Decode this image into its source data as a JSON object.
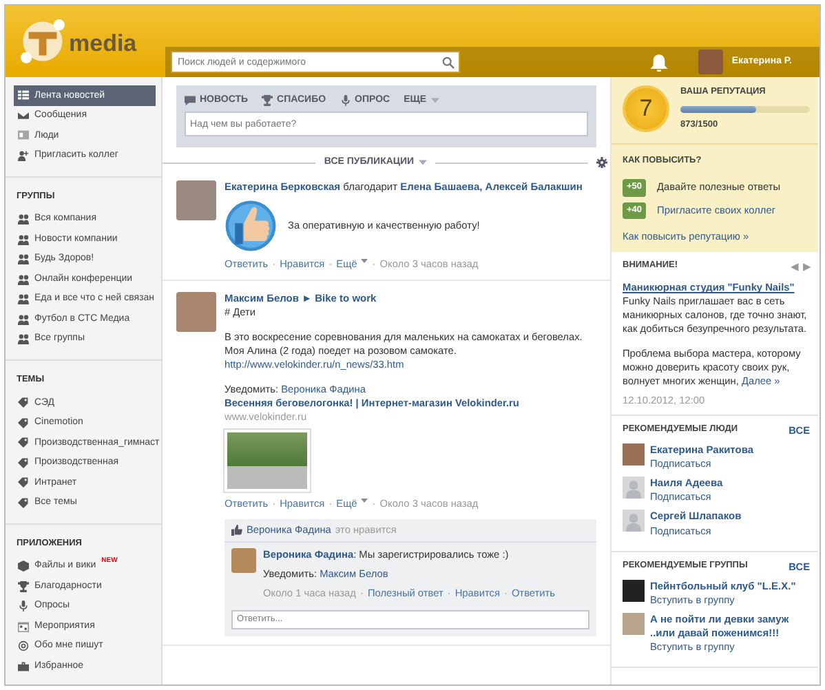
{
  "header": {
    "logo_text": "media",
    "search": {
      "placeholder": "Поиск людей и содержимого"
    },
    "user_name": "Екатерина Р."
  },
  "sidebar": {
    "sections": [
      {
        "items": [
          {
            "label": "Лента новостей",
            "selected": true
          },
          {
            "label": "Сообщения",
            "selected": false
          },
          {
            "label": "Люди",
            "selected": false
          },
          {
            "label": "Пригласить коллег",
            "selected": false
          }
        ]
      },
      {
        "title": "ГРУППЫ",
        "items": [
          {
            "label": "Вся компания",
            "selected": false
          },
          {
            "label": "Новости компании",
            "selected": false
          },
          {
            "label": "Будь Здоров!",
            "selected": false
          },
          {
            "label": "Онлайн конференции",
            "selected": false
          },
          {
            "label": "Еда и все что с ней связан",
            "selected": false
          },
          {
            "label": "Футбол в СТС Медиа",
            "selected": false
          },
          {
            "label": "Все группы",
            "selected": false
          }
        ]
      },
      {
        "title": "ТЕМЫ",
        "items": [
          {
            "label": "СЭД",
            "selected": false
          },
          {
            "label": "Cinemotion",
            "selected": false
          },
          {
            "label": "Производственная_гимнаст",
            "selected": false
          },
          {
            "label": "Производственная",
            "selected": false
          },
          {
            "label": "Интранет",
            "selected": false
          },
          {
            "label": "Все темы",
            "selected": false
          }
        ]
      },
      {
        "title": "ПРИЛОЖЕНИЯ",
        "items": [
          {
            "label": "Файлы и вики",
            "badge": "NEW",
            "selected": false
          },
          {
            "label": "Благодарности",
            "selected": false
          },
          {
            "label": "Опросы",
            "selected": false
          },
          {
            "label": "Мероприятия",
            "selected": false
          },
          {
            "label": "Обо мне пишут",
            "selected": false
          },
          {
            "label": "Избранное",
            "selected": false
          }
        ]
      }
    ]
  },
  "composer": {
    "tabs": [
      {
        "label": "НОВОСТЬ"
      },
      {
        "label": "СПАСИБО"
      },
      {
        "label": "ОПРОС"
      },
      {
        "label": "ЕЩЕ"
      }
    ],
    "placeholder": "Над чем вы работаете?"
  },
  "feed_filter": "ВСЕ ПУБЛИКАЦИИ",
  "posts": [
    {
      "kind": "thanks",
      "author": "Екатерина Берковская",
      "verb": "благодарит",
      "targets": "Елена Башаева, Алексей Балакшин",
      "text": "За оперативную и качественную работу!",
      "actions": [
        "Ответить",
        "Нравится",
        "Ещё"
      ],
      "separator": "·",
      "time": "Около 3 часов назад"
    },
    {
      "kind": "news",
      "author": "Максим Белов",
      "arrow": "►",
      "group": "Bike to work",
      "tag": "# Дети",
      "lines": [
        "В это воскресение соревнования для маленьких на самокатах и беговелах.",
        "Моя Алина (2 года) поедет на розовом самокате."
      ],
      "url": "http://www.velokinder.ru/n_news/33.htm",
      "notify_label": "Уведомить:",
      "notify_name": "Вероника Фадина",
      "link_title": "Весенняя беговелогонка! | Интернет-магазин Velokinder.ru",
      "link_domain": "www.velokinder.ru",
      "actions": [
        "Ответить",
        "Нравится",
        "Ещё"
      ],
      "separator": "·",
      "time": "Около 3 часов назад",
      "likes": {
        "name": "Вероника Фадина",
        "text": "это нравится"
      },
      "comment": {
        "author": "Вероника Фадина",
        "text": ": Мы зарегистрировались тоже :)",
        "notify_label": "Уведомить:",
        "notify_name": "Максим Белов",
        "time": "Около 1 часа назад",
        "actions": [
          "Полезный ответ",
          "Нравится",
          "Ответить"
        ],
        "separator": "·"
      },
      "reply_placeholder": "Ответить..."
    }
  ],
  "reputation": {
    "level_number": "7",
    "title": "ВАША РЕПУТАЦИЯ",
    "level": 0.582,
    "reading": "873/1500",
    "how_title": "КАК ПОВЫСИТЬ?",
    "ways": [
      {
        "points": "+50",
        "text": "Давайте полезные ответы",
        "kind": "text"
      },
      {
        "points": "+40",
        "text": "Пригласите своих коллег",
        "kind": "link"
      }
    ],
    "more_link": "Как повысить репутацию »"
  },
  "notice": {
    "title": "ВНИМАНИЕ!",
    "prev": "◀",
    "next": "▶",
    "ad_title": "Маникюрная студия \"Funky Nails\"",
    "ad_text": "Funky Nails приглашает вас в сеть маникюрных салонов, где точно знают, как добиться безупречного результата.",
    "ad_text2": "Проблема выбора мастера, которому можно доверить красоту своих рук, волнует многих женщин,",
    "more": "Далее »",
    "date": "12.10.2012, 12:00"
  },
  "recommended_people": {
    "title": "РЕКОМЕНДУЕМЫЕ ЛЮДИ",
    "all": "ВСЕ",
    "items": [
      {
        "name": "Екатерина Ракитова",
        "action": "Подписаться",
        "kind": "photo"
      },
      {
        "name": "Наиля Адеева",
        "action": "Подписаться",
        "kind": "default"
      },
      {
        "name": "Сергей Шлапаков",
        "action": "Подписаться",
        "kind": "default"
      }
    ]
  },
  "recommended_groups": {
    "title": "РЕКОМЕНДУЕМЫЕ ГРУППЫ",
    "all": "ВСЕ",
    "items": [
      {
        "name": "Пейнтбольный клуб \"L.E.X.\"",
        "action": "Вступить в группу"
      },
      {
        "name": "А не пойти ли девки замуж ..или давай поженимся!!!",
        "action": "Вступить в группу"
      }
    ]
  }
}
